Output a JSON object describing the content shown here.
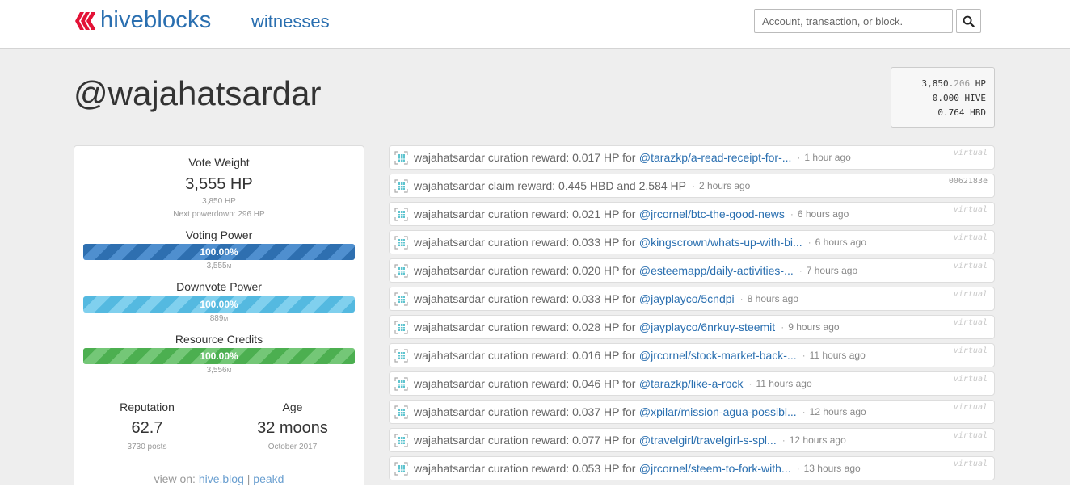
{
  "header": {
    "brand": "hiveblocks",
    "nav_witnesses": "witnesses",
    "search_placeholder": "Account, transaction, or block."
  },
  "account": {
    "name": "@wajahatsardar",
    "balances": {
      "hp_int": "3,850.",
      "hp_dec": "206",
      "hp_unit": "HP",
      "hive": "0.000",
      "hive_unit": "HIVE",
      "hbd": "0.764",
      "hbd_unit": "HBD"
    }
  },
  "stats": {
    "vote_weight_title": "Vote Weight",
    "vote_weight_value": "3,555 HP",
    "vote_weight_hp": "3,850 HP",
    "next_powerdown": "Next powerdown: 296 HP",
    "voting_power": {
      "title": "Voting Power",
      "percent": 100,
      "label": "100.00%",
      "value": "3,555",
      "suffix": "M"
    },
    "downvote_power": {
      "title": "Downvote Power",
      "percent": 100,
      "label": "100.00%",
      "value": "889",
      "suffix": "M"
    },
    "resource_credits": {
      "title": "Resource Credits",
      "percent": 100,
      "label": "100.00%",
      "value": "3,556",
      "suffix": "M"
    },
    "reputation_title": "Reputation",
    "reputation_value": "62.7",
    "reputation_sub": "3730 posts",
    "age_title": "Age",
    "age_value": "32 moons",
    "age_sub": "October 2017",
    "view_on_prefix": "view on:",
    "view_on_hiveblog": "hive.blog",
    "view_on_sep": "|",
    "view_on_peakd": "peakd"
  },
  "operations": [
    {
      "text": "wajahatsardar curation reward: 0.017 HP for",
      "link": "@tarazkp/a-read-receipt-for-...",
      "time": "1 hour ago",
      "tag": "virtual"
    },
    {
      "text": "wajahatsardar claim reward: 0.445 HBD and 2.584 HP",
      "link": "",
      "time": "2 hours ago",
      "tag": "0062183e"
    },
    {
      "text": "wajahatsardar curation reward: 0.021 HP for",
      "link": "@jrcornel/btc-the-good-news",
      "time": "6 hours ago",
      "tag": "virtual"
    },
    {
      "text": "wajahatsardar curation reward: 0.033 HP for",
      "link": "@kingscrown/whats-up-with-bi...",
      "time": "6 hours ago",
      "tag": "virtual"
    },
    {
      "text": "wajahatsardar curation reward: 0.020 HP for",
      "link": "@esteemapp/daily-activities-...",
      "time": "7 hours ago",
      "tag": "virtual"
    },
    {
      "text": "wajahatsardar curation reward: 0.033 HP for",
      "link": "@jayplayco/5cndpi",
      "time": "8 hours ago",
      "tag": "virtual"
    },
    {
      "text": "wajahatsardar curation reward: 0.028 HP for",
      "link": "@jayplayco/6nrkuy-steemit",
      "time": "9 hours ago",
      "tag": "virtual"
    },
    {
      "text": "wajahatsardar curation reward: 0.016 HP for",
      "link": "@jrcornel/stock-market-back-...",
      "time": "11 hours ago",
      "tag": "virtual"
    },
    {
      "text": "wajahatsardar curation reward: 0.046 HP for",
      "link": "@tarazkp/like-a-rock",
      "time": "11 hours ago",
      "tag": "virtual"
    },
    {
      "text": "wajahatsardar curation reward: 0.037 HP for",
      "link": "@xpilar/mission-agua-possibl...",
      "time": "12 hours ago",
      "tag": "virtual"
    },
    {
      "text": "wajahatsardar curation reward: 0.077 HP for",
      "link": "@travelgirl/travelgirl-s-spl...",
      "time": "12 hours ago",
      "tag": "virtual"
    },
    {
      "text": "wajahatsardar curation reward: 0.053 HP for",
      "link": "@jrcornel/steem-to-fork-with...",
      "time": "13 hours ago",
      "tag": "virtual"
    }
  ]
}
